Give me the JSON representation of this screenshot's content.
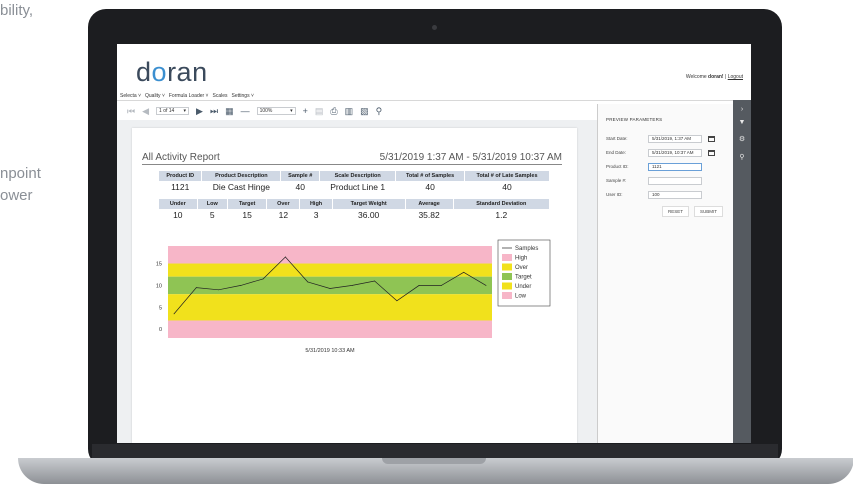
{
  "background_text": {
    "line1": "bility,",
    "line2": "npoint",
    "line3": "ower"
  },
  "app": {
    "logo": {
      "part1": "d",
      "part2": "o",
      "part3": "ran"
    },
    "welcome_prefix": "Welcome",
    "welcome_user": "doran!",
    "welcome_sep": "|",
    "logout_label": "Logout",
    "menu": [
      "Selecta ˅",
      "Quality ˅",
      "Formula Loader ˅",
      "Scales",
      "Settings ˅"
    ]
  },
  "toolbar": {
    "page_value": "1 of 14",
    "zoom_value": "100%"
  },
  "report": {
    "title": "All Activity Report",
    "range": "5/31/2019 1:37 AM - 5/31/2019 10:37 AM",
    "table1": {
      "headers": [
        "Product ID",
        "Product Description",
        "Sample #",
        "Scale Description",
        "Total # of Samples",
        "Total # of Late Samples"
      ],
      "values": [
        "1121",
        "Die Cast Hinge",
        "40",
        "Product Line 1",
        "40",
        "40"
      ]
    },
    "table2": {
      "headers": [
        "Under",
        "Low",
        "Target",
        "Over",
        "High",
        "Target Weight",
        "Average",
        "Standard Deviation"
      ],
      "values": [
        "10",
        "5",
        "15",
        "12",
        "3",
        "36.00",
        "35.82",
        "1.2"
      ]
    }
  },
  "chart_data": {
    "type": "line",
    "title": "",
    "xlabel": "5/31/2019 10:33 AM",
    "ylabel": "",
    "yticks": [
      "15",
      "10",
      "5",
      "0"
    ],
    "ylim": [
      -2,
      19
    ],
    "x": [
      1,
      2,
      3,
      4,
      5,
      6,
      7,
      8,
      9,
      10,
      11,
      12,
      13,
      14,
      15
    ],
    "series": [
      {
        "name": "Samples",
        "values": [
          3.5,
          9.5,
          9,
          10,
          11.5,
          16.5,
          10.8,
          9.3,
          10,
          11,
          6.5,
          10,
          10,
          13,
          10
        ]
      }
    ],
    "bands": [
      {
        "name": "High",
        "from": 15,
        "to": 19,
        "color": "#f7b6c8"
      },
      {
        "name": "Over",
        "from": 12,
        "to": 15,
        "color": "#f1e11c"
      },
      {
        "name": "Target",
        "from": 8,
        "to": 12,
        "color": "#8fc454"
      },
      {
        "name": "Under",
        "from": 2,
        "to": 8,
        "color": "#f1e11c"
      },
      {
        "name": "Low",
        "from": -2,
        "to": 2,
        "color": "#f7b6c8"
      }
    ],
    "legend": [
      "Samples",
      "High",
      "Over",
      "Target",
      "Under",
      "Low"
    ],
    "legend_position": "right",
    "line_color": "#222222"
  },
  "params": {
    "title": "PREVIEW PARAMETERS",
    "rows": [
      {
        "label": "Start Date:",
        "value": "5/31/2019, 1:37 AM"
      },
      {
        "label": "End Date:",
        "value": "5/31/2019, 10:37 AM"
      },
      {
        "label": "Product ID:",
        "value": "1121"
      },
      {
        "label": "Sample #:",
        "value": ""
      },
      {
        "label": "User ID:",
        "value": "100"
      }
    ],
    "reset_label": "RESET",
    "submit_label": "SUBMIT"
  },
  "colors": {
    "accent": "#3b8fd0",
    "sidebar": "#555a60",
    "header_fill": "#d0d8e4"
  },
  "icons": [
    "first-page-icon",
    "prev-page-icon",
    "next-page-icon",
    "last-page-icon",
    "multipage-icon",
    "zoom-out-icon",
    "zoom-in-icon",
    "highlight-icon",
    "print-icon",
    "print-layout-icon",
    "export-icon",
    "search-icon",
    "filter-icon",
    "gear-icon",
    "sidebar-search-icon"
  ]
}
